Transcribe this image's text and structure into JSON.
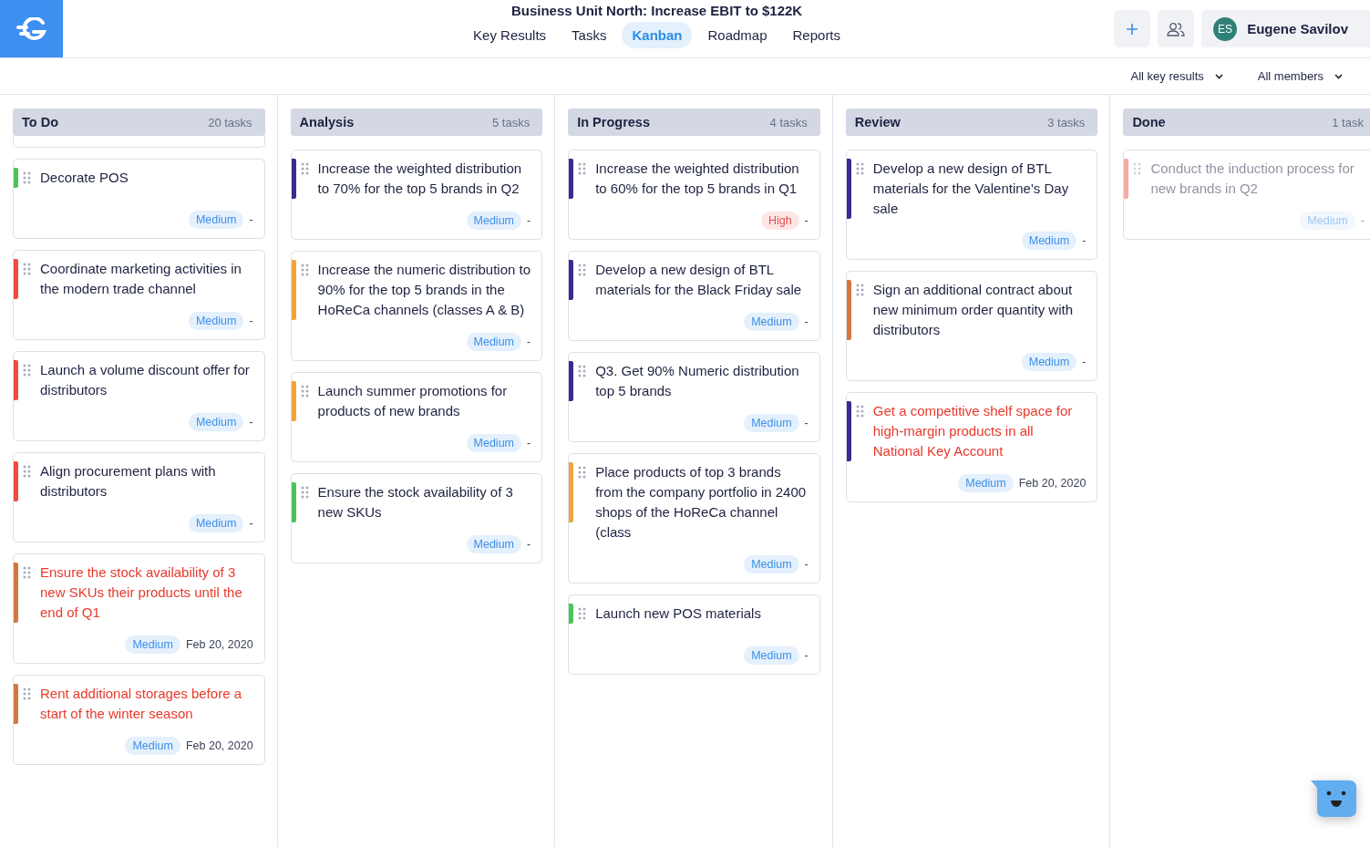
{
  "title": "Business Unit North: Increase EBIT to $122K",
  "tabs": [
    {
      "label": "Key Results",
      "selected": false
    },
    {
      "label": "Tasks",
      "selected": false
    },
    {
      "label": "Kanban",
      "selected": true
    },
    {
      "label": "Roadmap",
      "selected": false
    },
    {
      "label": "Reports",
      "selected": false
    }
  ],
  "user": {
    "initials": "ES",
    "name": "Eugene Savilov"
  },
  "filters": [
    {
      "label": "All key results"
    },
    {
      "label": "All members"
    }
  ],
  "columns": [
    {
      "name": "To Do",
      "count": "20 tasks",
      "cards": [
        {
          "title": "Decorate POS",
          "color": "#4cc35a",
          "overdue": false,
          "completed": false,
          "priority": {
            "kind": "medium",
            "label": "Medium"
          },
          "date": "-"
        },
        {
          "title": "Coordinate marketing activities in the modern trade channel",
          "color": "#ef4b45",
          "overdue": false,
          "completed": false,
          "priority": {
            "kind": "medium",
            "label": "Medium"
          },
          "date": "-"
        },
        {
          "title": "Launch a volume discount offer for distributors",
          "color": "#ef4b45",
          "overdue": false,
          "completed": false,
          "priority": {
            "kind": "medium",
            "label": "Medium"
          },
          "date": "-"
        },
        {
          "title": "Align procurement plans with distributors",
          "color": "#ef4b45",
          "overdue": false,
          "completed": false,
          "priority": {
            "kind": "medium",
            "label": "Medium"
          },
          "date": "-"
        },
        {
          "title": "Ensure the stock availability of 3 new SKUs their products until the end of Q1",
          "color": "#d4773f",
          "overdue": true,
          "completed": false,
          "priority": {
            "kind": "medium",
            "label": "Medium"
          },
          "date": "Feb 20, 2020"
        },
        {
          "title": "Rent additional storages before a start of the winter season",
          "color": "#d4773f",
          "overdue": true,
          "completed": false,
          "priority": {
            "kind": "medium",
            "label": "Medium"
          },
          "date": "Feb 20, 2020"
        }
      ]
    },
    {
      "name": "Analysis",
      "count": "5 tasks",
      "cards": [
        {
          "title": "Increase the weighted distribution to 70% for the top 5 brands in Q2",
          "color": "#3b2b8f",
          "overdue": false,
          "completed": false,
          "priority": {
            "kind": "medium",
            "label": "Medium"
          },
          "date": "-"
        },
        {
          "title": "Increase the numeric distribution to 90% for the top 5 brands in the HoReCa channels (classes A & B)",
          "color": "#f0a53a",
          "overdue": false,
          "completed": false,
          "priority": {
            "kind": "medium",
            "label": "Medium"
          },
          "date": "-"
        },
        {
          "title": "Launch summer promotions for products of new brands",
          "color": "#f0a53a",
          "overdue": false,
          "completed": false,
          "priority": {
            "kind": "medium",
            "label": "Medium"
          },
          "date": "-"
        },
        {
          "title": "Ensure the stock availability of 3 new SKUs",
          "color": "#4cc35a",
          "overdue": false,
          "completed": false,
          "priority": {
            "kind": "medium",
            "label": "Medium"
          },
          "date": "-"
        }
      ]
    },
    {
      "name": "In Progress",
      "count": "4 tasks",
      "cards": [
        {
          "title": "Increase the weighted distribution to 60% for the top 5 brands in Q1",
          "color": "#3b2b8f",
          "overdue": false,
          "completed": false,
          "priority": {
            "kind": "high",
            "label": "High"
          },
          "date": "-"
        },
        {
          "title": "Develop a new design of BTL materials for the Black Friday sale",
          "color": "#3b2b8f",
          "overdue": false,
          "completed": false,
          "priority": {
            "kind": "medium",
            "label": "Medium"
          },
          "date": "-"
        },
        {
          "title": "Q3. Get 90% Numeric distribution top 5 brands",
          "color": "#3b2b8f",
          "overdue": false,
          "completed": false,
          "priority": {
            "kind": "medium",
            "label": "Medium"
          },
          "date": "-"
        },
        {
          "title": "Place products of top 3 brands from the company portfolio in 2400 shops of the HoReCa channel (class",
          "color": "#f0a53a",
          "overdue": false,
          "completed": false,
          "priority": {
            "kind": "medium",
            "label": "Medium"
          },
          "date": "-"
        },
        {
          "title": "Launch new POS materials",
          "color": "#4cc35a",
          "overdue": false,
          "completed": false,
          "priority": {
            "kind": "medium",
            "label": "Medium"
          },
          "date": "-"
        }
      ]
    },
    {
      "name": "Review",
      "count": "3 tasks",
      "cards": [
        {
          "title": "Develop a new design of BTL materials for the Valentine's Day sale",
          "color": "#3b2b8f",
          "overdue": false,
          "completed": false,
          "priority": {
            "kind": "medium",
            "label": "Medium"
          },
          "date": "-"
        },
        {
          "title": "Sign an additional contract about new minimum order quantity with distributors",
          "color": "#d4773f",
          "overdue": false,
          "completed": false,
          "priority": {
            "kind": "medium",
            "label": "Medium"
          },
          "date": "-"
        },
        {
          "title": "Get a competitive shelf space for high-margin products in all National Key Account",
          "color": "#3b2b8f",
          "overdue": true,
          "completed": false,
          "priority": {
            "kind": "medium",
            "label": "Medium"
          },
          "date": "Feb 20, 2020"
        }
      ]
    },
    {
      "name": "Done",
      "count": "1 task",
      "cards": [
        {
          "title": "Conduct the induction process for new brands in Q2",
          "color": "#f5aaa5",
          "overdue": false,
          "completed": true,
          "priority": {
            "kind": "medium",
            "label": "Medium"
          },
          "date": "-"
        }
      ]
    }
  ]
}
